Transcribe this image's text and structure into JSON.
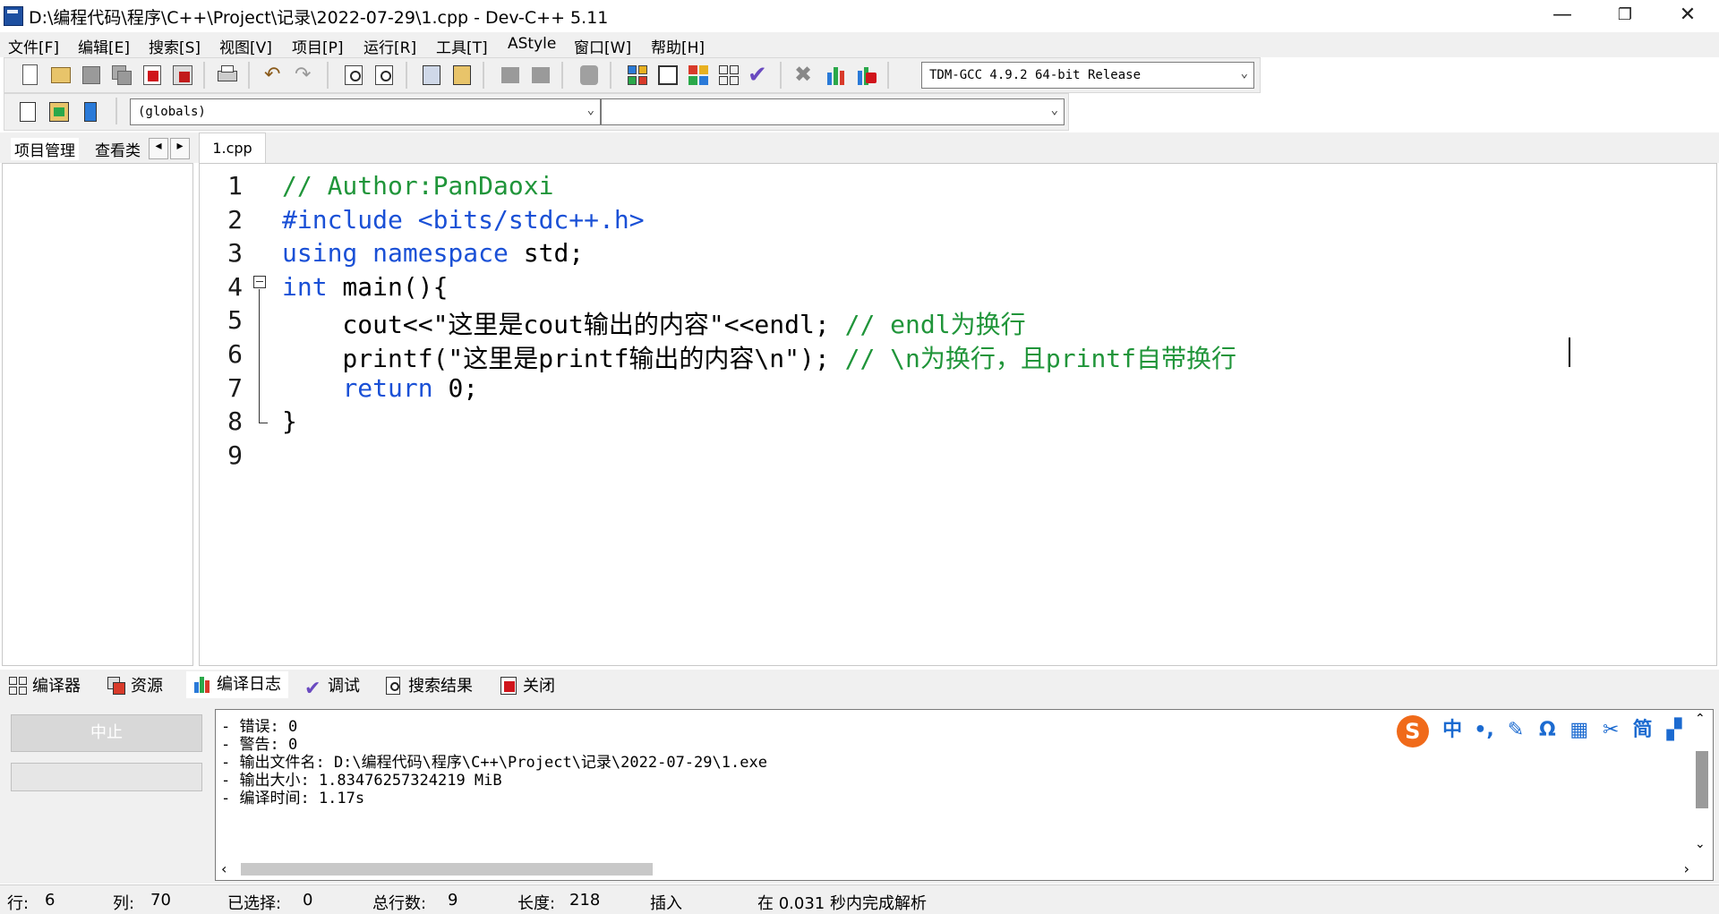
{
  "window": {
    "title": "D:\\编程代码\\程序\\C++\\Project\\记录\\2022-07-29\\1.cpp - Dev-C++ 5.11",
    "minimize": "—",
    "restore": "❐",
    "close": "✕"
  },
  "menu": [
    "文件[F]",
    "编辑[E]",
    "搜索[S]",
    "视图[V]",
    "项目[P]",
    "运行[R]",
    "工具[T]",
    "AStyle",
    "窗口[W]",
    "帮助[H]"
  ],
  "toolbar": {
    "compiler_select": "TDM-GCC 4.9.2 64-bit Release",
    "scope_select": "(globals)",
    "symbol_select": ""
  },
  "left_panel": {
    "tabs": [
      "项目管理",
      "查看类"
    ],
    "scroll_left": "◂",
    "scroll_right": "▸"
  },
  "editor": {
    "tab": "1.cpp",
    "lines": [
      {
        "n": "1",
        "parts": [
          {
            "t": "// Author:PanDaoxi",
            "c": "cm"
          }
        ]
      },
      {
        "n": "2",
        "parts": [
          {
            "t": "#include <bits/stdc++.h>",
            "c": "kw"
          }
        ]
      },
      {
        "n": "3",
        "parts": [
          {
            "t": "using namespace",
            "c": "kw"
          },
          {
            "t": " std;",
            "c": "str"
          }
        ]
      },
      {
        "n": "4",
        "parts": [
          {
            "t": "int",
            "c": "kw"
          },
          {
            "t": " main(){",
            "c": "str"
          }
        ]
      },
      {
        "n": "5",
        "parts": [
          {
            "t": "    cout<<\"这里是cout输出的内容\"<<endl; ",
            "c": "str"
          },
          {
            "t": "// endl为换行",
            "c": "cm"
          }
        ]
      },
      {
        "n": "6",
        "parts": [
          {
            "t": "    printf(\"这里是printf输出的内容\\n\"); ",
            "c": "str"
          },
          {
            "t": "// \\n为换行，且printf自带换行",
            "c": "cm"
          }
        ]
      },
      {
        "n": "7",
        "parts": [
          {
            "t": "    ",
            "c": "str"
          },
          {
            "t": "return",
            "c": "kw"
          },
          {
            "t": " 0;",
            "c": "str"
          }
        ]
      },
      {
        "n": "8",
        "parts": [
          {
            "t": "}",
            "c": "str"
          }
        ]
      },
      {
        "n": "9",
        "parts": []
      }
    ]
  },
  "bottom_tabs": [
    "编译器",
    "资源",
    "编译日志",
    "调试",
    "搜索结果",
    "关闭"
  ],
  "bottom_panel": {
    "abort": "中止",
    "log": [
      "- 错误: 0",
      "- 警告: 0",
      "- 输出文件名: D:\\编程代码\\程序\\C++\\Project\\记录\\2022-07-29\\1.exe",
      "- 输出大小: 1.83476257324219 MiB",
      "- 编译时间: 1.17s"
    ],
    "ime": {
      "logo": "S",
      "items": [
        "中",
        "•,",
        "✎",
        "Ω",
        "▦",
        "✂",
        "简",
        "▞"
      ]
    }
  },
  "status": {
    "row_label": "行:",
    "row": "6",
    "col_label": "列:",
    "col": "70",
    "sel_label": "已选择:",
    "sel": "0",
    "lines_label": "总行数:",
    "lines": "9",
    "len_label": "长度:",
    "len": "218",
    "mode": "插入",
    "parse": "在 0.031 秒内完成解析"
  }
}
